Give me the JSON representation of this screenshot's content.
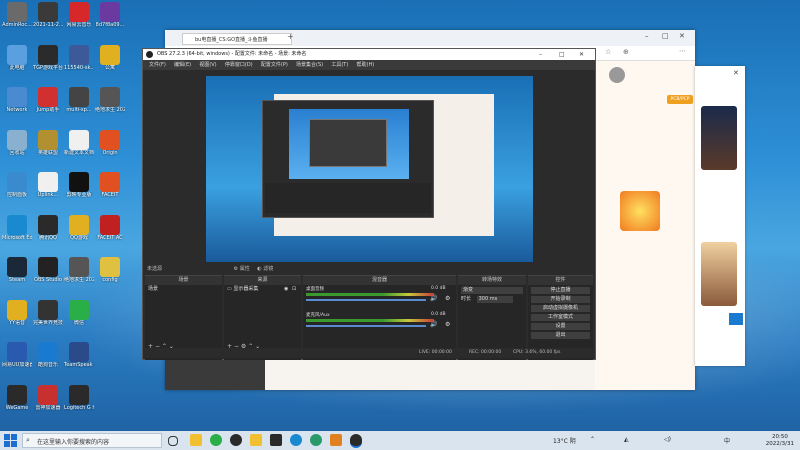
{
  "desktop": {
    "icons": [
      {
        "label": "AdminRoc...",
        "color": "#6a6a6a"
      },
      {
        "label": "2021-11-2... 18:15:56...",
        "color": "#3a3a3a"
      },
      {
        "label": "网易云音乐",
        "color": "#d6282b"
      },
      {
        "label": "8d7f8a09...",
        "color": "#6b3aa0"
      },
      {
        "label": "此电脑",
        "color": "#5aa0e0"
      },
      {
        "label": "TGP游戏平台",
        "color": "#2b2b2b"
      },
      {
        "label": "115540-sk...",
        "color": "#3c5a9a"
      },
      {
        "label": "公寓",
        "color": "#e0b020"
      },
      {
        "label": "Network",
        "color": "#4a8ad0"
      },
      {
        "label": "Jump助手",
        "color": "#d03030"
      },
      {
        "label": "multi-sp...",
        "color": "#444"
      },
      {
        "label": "绝地求生 2021102...",
        "color": "#555"
      },
      {
        "label": "回收站",
        "color": "#8ab0d0"
      },
      {
        "label": "英雄联盟",
        "color": "#b09030"
      },
      {
        "label": "新建文本文档",
        "color": "#f0f0f0"
      },
      {
        "label": "Origin",
        "color": "#e05020"
      },
      {
        "label": "控制面板",
        "color": "#3a8ad0"
      },
      {
        "label": "Uplink...",
        "color": "#f0f0f0"
      },
      {
        "label": "剪映专业版",
        "color": "#111"
      },
      {
        "label": "FACEIT",
        "color": "#e05020"
      },
      {
        "label": "Microsoft Edge",
        "color": "#1a8ad0"
      },
      {
        "label": "腾讯QQ",
        "color": "#2a2a2a"
      },
      {
        "label": "QQ游戏",
        "color": "#e0b020"
      },
      {
        "label": "FACEIT AC",
        "color": "#c02020"
      },
      {
        "label": "Steam",
        "color": "#1b2838"
      },
      {
        "label": "OBS Studio",
        "color": "#222"
      },
      {
        "label": "绝地求生 2022030...",
        "color": "#555"
      },
      {
        "label": "config",
        "color": "#e0c040"
      },
      {
        "label": "YY语音",
        "color": "#e0b020"
      },
      {
        "label": "完美世界竞技平台",
        "color": "#333"
      },
      {
        "label": "微信",
        "color": "#2aae47"
      },
      {
        "label": "",
        "color": "transparent"
      },
      {
        "label": "网易UU加速器",
        "color": "#2a5ab0"
      },
      {
        "label": "酷狗音乐",
        "color": "#1a7ad0"
      },
      {
        "label": "TeamSpeak 3",
        "color": "#2a4a8a"
      },
      {
        "label": "",
        "color": "transparent"
      },
      {
        "label": "WeGame",
        "color": "#2a2a2a"
      },
      {
        "label": "雷神加速器",
        "color": "#c83030"
      },
      {
        "label": "Logitech G HUB",
        "color": "#2a2a2a"
      },
      {
        "label": "",
        "color": "transparent"
      }
    ]
  },
  "browser": {
    "tab_title": "bu电直播_CS:GO直播_斗鱼直播",
    "right_panel_tag": "PCB/PCP",
    "sidebar_labels": [
      "体验",
      "设置"
    ]
  },
  "obs": {
    "title": "OBS 27.2.3 (64-bit, windows) - 配置文件: 未命名 - 场景: 未命名",
    "menu": [
      "文件(F)",
      "编辑(E)",
      "视图(V)",
      "停靠窗口(D)",
      "配置文件(P)",
      "场景集合(S)",
      "工具(T)",
      "帮助(H)"
    ],
    "no_source_selected": "未选源",
    "properties_label": "属性",
    "filters_label": "滤镜",
    "docks": {
      "scenes": {
        "title": "场景",
        "items": [
          "场景"
        ]
      },
      "sources": {
        "title": "来源",
        "items": [
          "显示器采集"
        ]
      },
      "mixer": {
        "title": "混音器",
        "channels": [
          {
            "name": "桌面音频",
            "db": "0.0 dB"
          },
          {
            "name": "麦克风/Aux",
            "db": "0.0 dB"
          }
        ]
      },
      "transitions": {
        "title": "转场特效",
        "type": "渐变",
        "duration_label": "时长",
        "duration": "300 ms"
      },
      "controls": {
        "title": "控件",
        "buttons": [
          "停止直播",
          "开始录制",
          "启动虚拟摄像机",
          "工作室模式",
          "设置",
          "退出"
        ]
      }
    },
    "status": {
      "live": "LIVE: 00:00:00",
      "rec": "REC: 00:00:00",
      "cpu": "CPU: 3.6%, 60.00 fps"
    }
  },
  "taskbar": {
    "search_placeholder": "在这里输入你要搜索的内容",
    "weather": "13°C 阴",
    "time": "20:50",
    "date": "2022/3/31",
    "ime": "中"
  },
  "colors": {
    "taskbar": "#d9e4ef",
    "obs_bg": "#2b2b2b",
    "accent": "#1a6fb5"
  }
}
